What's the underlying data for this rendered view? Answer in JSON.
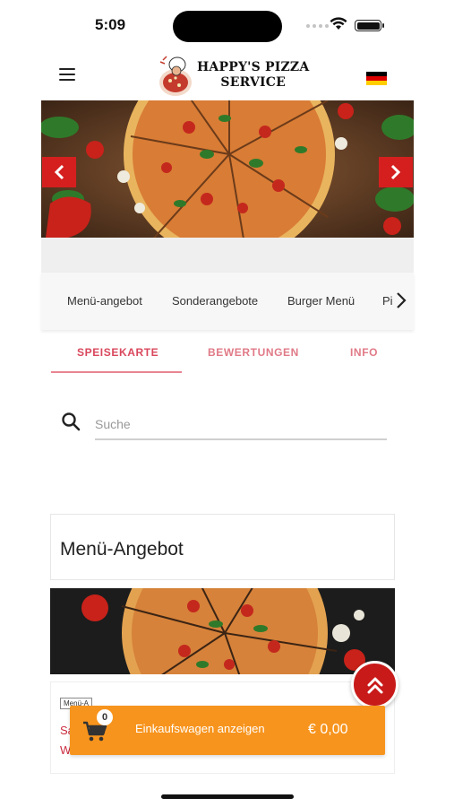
{
  "status_bar": {
    "time": "5:09"
  },
  "header": {
    "logo_line1": "HAPPY'S PIZZA",
    "logo_line2": "SERVICE",
    "language_flag": "de"
  },
  "categories": [
    "Menü-angebot",
    "Sonderangebote",
    "Burger Menü",
    "Pi"
  ],
  "tabs": [
    "SPEISEKARTE",
    "BEWERTUNGEN",
    "INFO"
  ],
  "active_tab": "SPEISEKARTE",
  "search": {
    "placeholder": "Suche",
    "value": ""
  },
  "section": {
    "title": "Menü-Angebot"
  },
  "product": {
    "tag": "Menü-A",
    "name_line1": "Sa",
    "name_line2": "W"
  },
  "cart": {
    "count": "0",
    "label": "Einkaufswagen anzeigen",
    "total": "€ 0,00"
  },
  "colors": {
    "accent_red": "#d51f1f",
    "tab_pink": "#e07a87",
    "cart_orange": "#f7941d"
  },
  "icons": [
    "menu-icon",
    "chevron-left-icon",
    "chevron-right-icon",
    "search-icon",
    "cart-icon",
    "double-chevron-up-icon",
    "flag-icon"
  ]
}
